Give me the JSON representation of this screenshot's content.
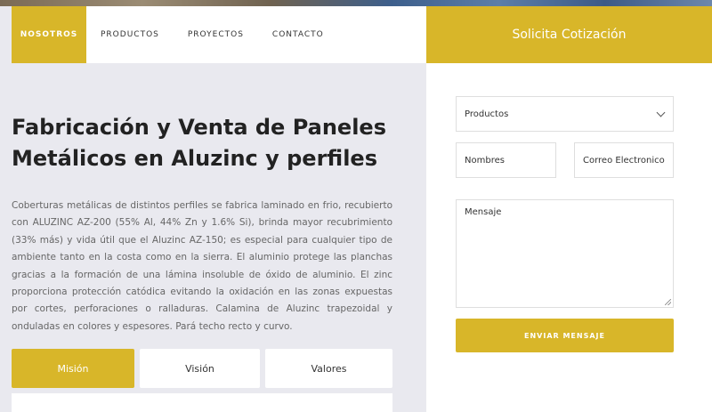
{
  "nav": {
    "items": [
      "NOSOTROS",
      "PRODUCTOS",
      "PROYECTOS",
      "CONTACTO"
    ]
  },
  "quote": {
    "title": "Solicita Cotización",
    "products_select": "Productos",
    "name_placeholder": "Nombres",
    "email_placeholder": "Correo Electronico",
    "message_placeholder": "Mensaje",
    "send_label": "ENVIAR MENSAJE"
  },
  "main": {
    "headline_line1": "Fabricación y Venta de Paneles",
    "headline_line2": "Metálicos en Aluzinc y perfiles",
    "body": "Coberturas metálicas de distintos perfiles se fabrica laminado en frio, recubierto con ALUZINC AZ-200 (55% Al, 44% Zn y 1.6% Si), brinda mayor recubrimiento (33% más) y vida útil que el Aluzinc AZ-150; es especial para cualquier tipo de ambiente tanto en la costa como en la sierra. El aluminio protege las planchas gracias a la formación de una lámina insoluble de óxido de aluminio. El zinc proporciona protección catódica evitando la oxidación en las zonas expuestas por cortes, perforaciones o ralladuras. Calamina de Aluzinc trapezoidal y onduladas en colores y espesores. Pará techo recto y curvo."
  },
  "tabs": [
    "Misión",
    "Visión",
    "Valores"
  ],
  "colors": {
    "accent": "#d8b629",
    "background": "#e9e9ef"
  }
}
